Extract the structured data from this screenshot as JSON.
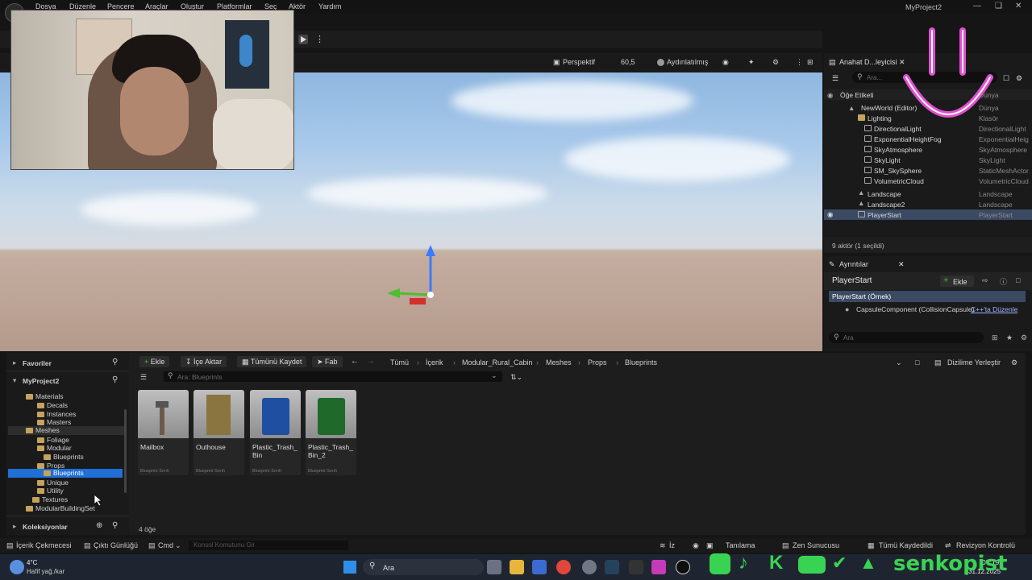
{
  "menu": {
    "items": [
      "Dosya",
      "Düzenle",
      "Pencere",
      "Araçlar",
      "Oluştur",
      "Platformlar",
      "Seç",
      "Aktör",
      "Yardım"
    ],
    "project_title": "MyProject2"
  },
  "viewport": {
    "view_mode": "Perspektif",
    "fov": "60,5",
    "lighting": "Aydınlatılmış"
  },
  "outliner": {
    "tab_title": "Anahat D...leyicisi",
    "search_placeholder": "Ara...",
    "col_label": "Öğe Etiketi",
    "col_type": "Dünya",
    "rows": [
      {
        "name": "NewWorld (Editor)",
        "type": "Dünya"
      },
      {
        "name": "Lighting",
        "type": "Klasör"
      },
      {
        "name": "DirectionalLight",
        "type": "DirectionalLight"
      },
      {
        "name": "ExponentialHeightFog",
        "type": "ExponentialHeig"
      },
      {
        "name": "SkyAtmosphere",
        "type": "SkyAtmosphere"
      },
      {
        "name": "SkyLight",
        "type": "SkyLight"
      },
      {
        "name": "SM_SkySphere",
        "type": "StaticMeshActor"
      },
      {
        "name": "VolumetricCloud",
        "type": "VolumetricCloud"
      },
      {
        "name": "Landscape",
        "type": "Landscape"
      },
      {
        "name": "Landscape2",
        "type": "Landscape"
      },
      {
        "name": "PlayerStart",
        "type": "PlayerStart"
      }
    ],
    "status": "9 aktör (1 seçildi)"
  },
  "details": {
    "tab_title": "Ayrıntılar",
    "actor_name": "PlayerStart",
    "add_label": "Ekle",
    "instance_label": "PlayerStart (Örnek)",
    "component_label": "CapsuleComponent (CollisionCapsule)",
    "edit_cpp": "C++'ta Düzenle",
    "search_placeholder": "Ara"
  },
  "content_browser": {
    "favorites": "Favoriler",
    "project": "MyProject2",
    "collections": "Koleksiyonlar",
    "tree": [
      {
        "label": "Materials",
        "depth": 1
      },
      {
        "label": "Decals",
        "depth": 2
      },
      {
        "label": "Instances",
        "depth": 2
      },
      {
        "label": "Masters",
        "depth": 2
      },
      {
        "label": "Meshes",
        "depth": 1
      },
      {
        "label": "Foliage",
        "depth": 2
      },
      {
        "label": "Modular",
        "depth": 2
      },
      {
        "label": "Blueprints",
        "depth": 3
      },
      {
        "label": "Props",
        "depth": 2
      },
      {
        "label": "Blueprints",
        "depth": 3
      },
      {
        "label": "Unique",
        "depth": 2
      },
      {
        "label": "Utility",
        "depth": 2
      },
      {
        "label": "Textures",
        "depth": 1
      },
      {
        "label": "ModularBuildingSet",
        "depth": 0
      }
    ],
    "buttons": {
      "add": "Ekle",
      "import": "İçe Aktar",
      "save_all": "Tümünü Kaydet",
      "fab": "Fab"
    },
    "breadcrumb": [
      "Tümü",
      "İçerik",
      "Modular_Rural_Cabin",
      "Meshes",
      "Props",
      "Blueprints"
    ],
    "dock_label": "Dizilime Yerleştir",
    "search_placeholder": "Ara: Blueprints",
    "assets": [
      {
        "name": "Mailbox",
        "type": "Blueprint Sınıfı"
      },
      {
        "name": "Outhouse",
        "type": "Blueprint Sınıfı"
      },
      {
        "name": "Plastic_Trash_\nBin",
        "type": "Blueprint Sınıfı"
      },
      {
        "name": "Plastic_Trash_\nBin_2",
        "type": "Blueprint Sınıfı"
      }
    ],
    "item_count": "4 öğe"
  },
  "statusbar": {
    "content_drawer": "İçerik Çekmecesi",
    "output_log": "Çıktı Günlüğü",
    "cmd": "Cmd",
    "console_placeholder": "Konsol Komutunu Gir",
    "trace": "İz",
    "diagnose": "Tanılama",
    "zen": "Zen Sunucusu",
    "saved": "Tümü Kaydedildi",
    "revision": "Revizyon Kontrolü"
  },
  "taskbar": {
    "temp": "4°C",
    "weather": "Hafif yağ./kar",
    "search": "Ara",
    "time": "07:19",
    "date": "31.12.2025"
  },
  "overlay": {
    "channel": "senkopist"
  },
  "colors": {
    "selection": "#3b4a63",
    "tree_selection": "#1f6fd6",
    "accent_green": "#39d353",
    "smiley_pink": "#e14fd0"
  }
}
